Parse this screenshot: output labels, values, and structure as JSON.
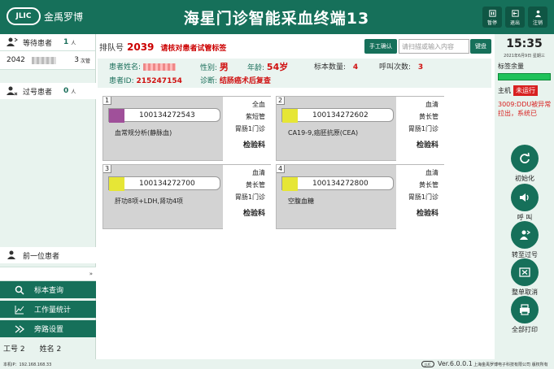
{
  "header": {
    "logo_mark": "JLIC",
    "logo_text": "金禹罗博",
    "title": "海星门诊智能采血终端13",
    "buttons": [
      {
        "label": "暂停",
        "icon": "pause-icon"
      },
      {
        "label": "退出",
        "icon": "exit-icon"
      },
      {
        "label": "注销",
        "icon": "logout-icon"
      }
    ]
  },
  "left": {
    "waiting_label": "等待患者",
    "waiting_count": "1",
    "waiting_unit": "人",
    "queue": [
      {
        "number": "2042",
        "count": "3",
        "unit": "次管"
      }
    ],
    "missed_label": "过号患者",
    "missed_count": "0",
    "missed_unit": "人",
    "prev_label": "前一位患者",
    "nav": [
      {
        "label": "标本查询",
        "icon": "search-icon"
      },
      {
        "label": "工作量统计",
        "icon": "chart-icon"
      },
      {
        "label": "旁路设置",
        "icon": "bypass-icon"
      }
    ],
    "worker_no": "工号 2",
    "worker_name": "姓名 2"
  },
  "main": {
    "queue_label": "排队号",
    "queue_no": "2039",
    "tip": "请核对患者试管标签",
    "manual_btn": "手工确认",
    "scan_placeholder": "请扫描或输入内容",
    "keyboard_btn": "键盘",
    "patient": {
      "name_label": "患者姓名:",
      "gender_label": "性别:",
      "gender": "男",
      "age_label": "年龄:",
      "age": "54岁",
      "sample_count_label": "标本数量:",
      "sample_count": "4",
      "call_count_label": "呼叫次数:",
      "call_count": "3",
      "id_label": "患者ID:",
      "id": "215247154",
      "diag_label": "诊断:",
      "diag": "结肠癌术后复查"
    },
    "samples": [
      {
        "idx": "1",
        "code": "100134272543",
        "test": "血常规分析(静脉血)",
        "type": "全血",
        "tube": "紫短管",
        "clinic": "胃肠1门诊",
        "dept": "检验科",
        "color": "#a0509a"
      },
      {
        "idx": "2",
        "code": "100134272602",
        "test": "CA19-9,癌胚抗原(CEA)",
        "type": "血清",
        "tube": "黄长管",
        "clinic": "胃肠1门诊",
        "dept": "检验科",
        "color": "#e6e636"
      },
      {
        "idx": "3",
        "code": "100134272700",
        "test": "肝功8项+LDH,肾功4项",
        "type": "血清",
        "tube": "黄长管",
        "clinic": "胃肠1门诊",
        "dept": "检验科",
        "color": "#e6e636"
      },
      {
        "idx": "4",
        "code": "100134272800",
        "test": "空腹血糖",
        "type": "血清",
        "tube": "黄长管",
        "clinic": "胃肠1门诊",
        "dept": "检验科",
        "color": "#e6e636"
      }
    ]
  },
  "right": {
    "time": "15:35",
    "date": "2021年6月9日 星期三",
    "remaining_label": "标签余量",
    "remaining_fraction": 1.0,
    "host_label": "主机",
    "host_status": "未运行",
    "error": "3009:DDU被异常拉出，系统已",
    "buttons": [
      {
        "label": "初始化",
        "icon": "refresh-icon"
      },
      {
        "label": "呼 叫",
        "icon": "speaker-icon"
      },
      {
        "label": "转至过号",
        "icon": "transfer-icon"
      },
      {
        "label": "整单取消",
        "icon": "cancel-icon"
      },
      {
        "label": "全部打印",
        "icon": "printer-icon"
      }
    ]
  },
  "footer": {
    "ip": "本机IP：192.168.168.33",
    "logo_mark": "JLIC",
    "version": "Ver.6.0.0.1",
    "company": "上海金禹罗博电子科技有限公司 版权所有"
  }
}
